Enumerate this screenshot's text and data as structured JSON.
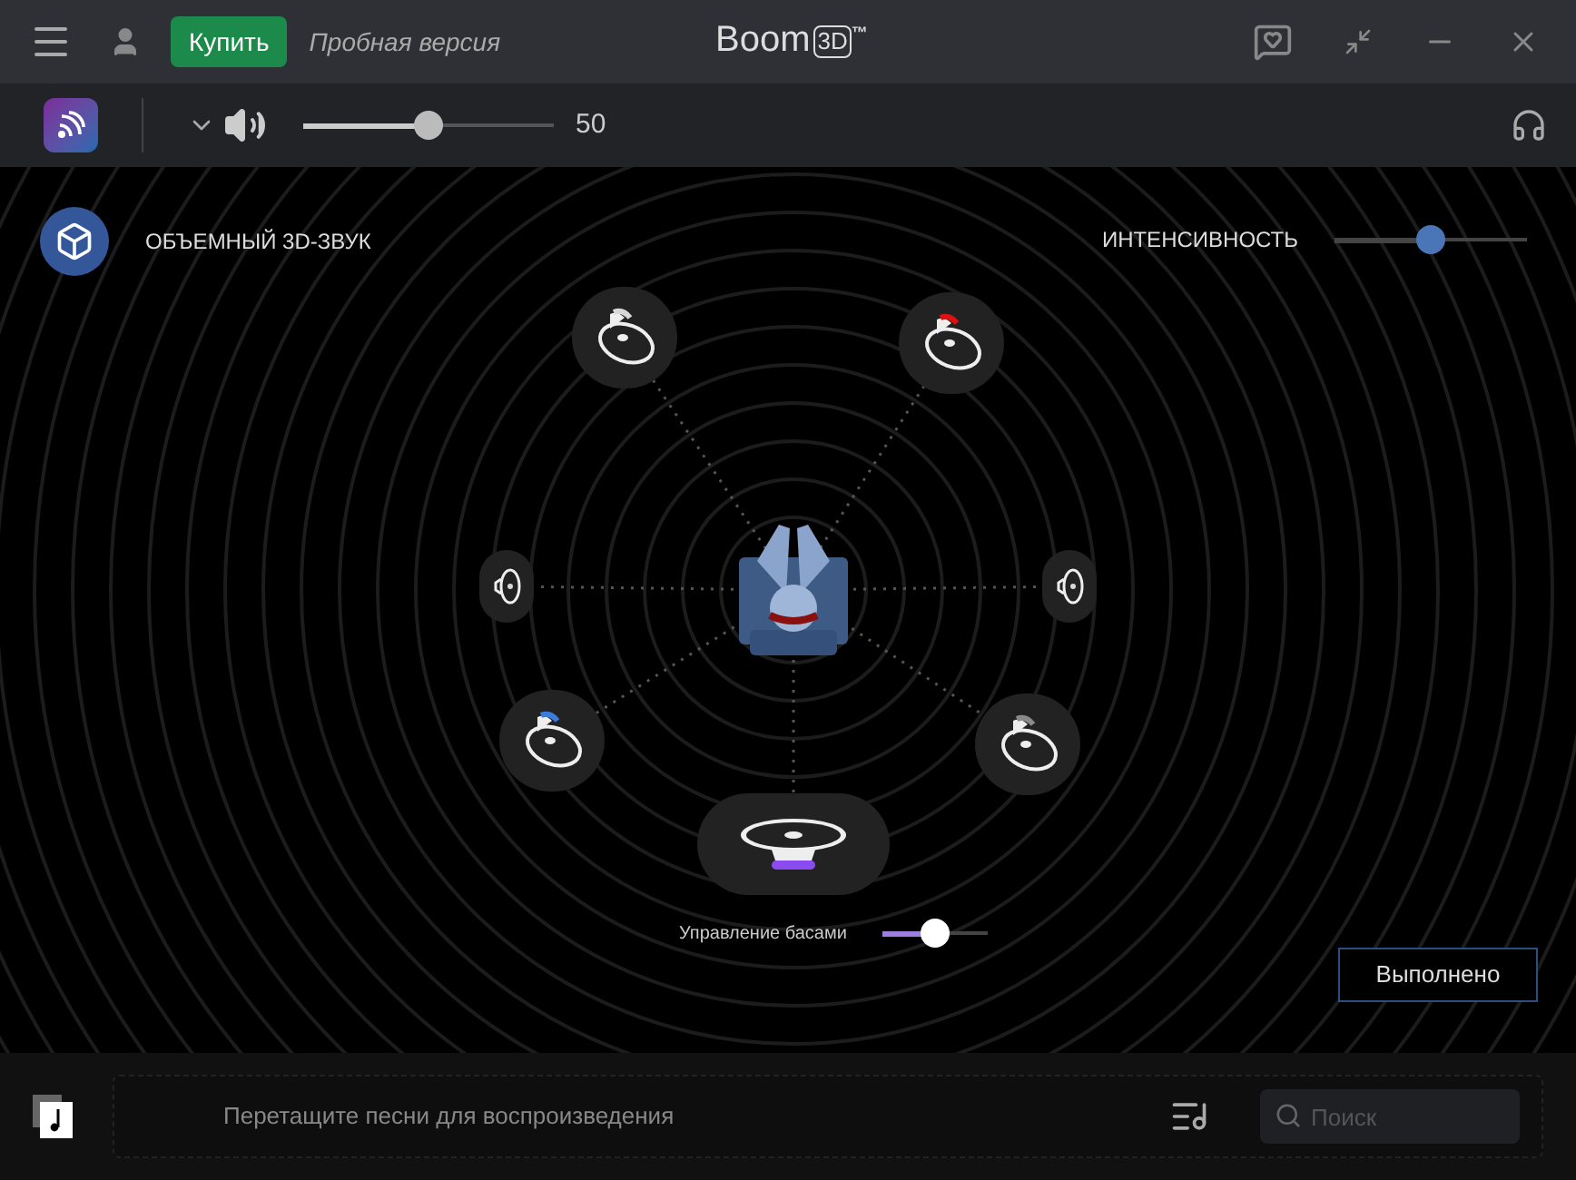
{
  "title_bar": {
    "buy_button": "Купить",
    "trial_label": "Пробная версия",
    "logo": {
      "word": "Boom",
      "badge": "3D",
      "mark": "™"
    }
  },
  "toolbar": {
    "volume": {
      "level": 0.5,
      "reading": "50"
    }
  },
  "effect": {
    "label": "ОБЪЕМНЫЙ 3D-ЗВУК",
    "intensity": {
      "label": "ИНТЕНСИВНОСТЬ",
      "level": 0.5
    }
  },
  "speakers": [
    {
      "kind": "cone",
      "color": "#d8d8d8"
    },
    {
      "kind": "cone",
      "color": "#e01010"
    },
    {
      "kind": "side",
      "color": "#d8d8d8"
    },
    {
      "kind": "side",
      "color": "#d8d8d8"
    },
    {
      "kind": "cone",
      "color": "#3b7ddd"
    },
    {
      "kind": "cone",
      "color": "#8a8a8a"
    },
    {
      "kind": "sub",
      "color": "#8a4cf0"
    }
  ],
  "bass": {
    "label": "Управление басами",
    "level": 0.5
  },
  "done_button": "Выполнено",
  "footer": {
    "drop_hint": "Перетащите песни для воспроизведения",
    "search": {
      "placeholder": "Поиск"
    }
  }
}
